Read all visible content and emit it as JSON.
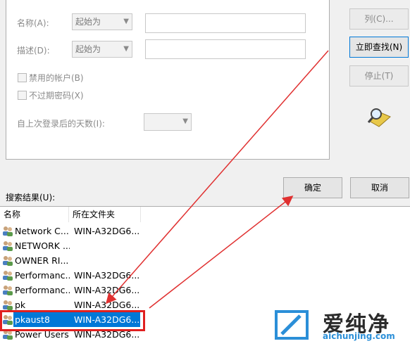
{
  "query": {
    "name_label": "名称(A):",
    "name_mode": "起始为",
    "desc_label": "描述(D):",
    "desc_mode": "起始为",
    "disabled_accounts": "禁用的帐户(B)",
    "no_expire_pwd": "不过期密码(X)",
    "days_since_logon": "自上次登录后的天数(I):"
  },
  "buttons": {
    "columns": "列(C)...",
    "find_now": "立即查找(N)",
    "stop": "停止(T)",
    "ok": "确定",
    "cancel": "取消"
  },
  "results": {
    "label": "搜索结果(U):",
    "columns": [
      "名称",
      "所在文件夹"
    ],
    "rows": [
      {
        "name": "Network C...",
        "folder": "WIN-A32DG6..."
      },
      {
        "name": "NETWORK ...",
        "folder": ""
      },
      {
        "name": "OWNER RI...",
        "folder": ""
      },
      {
        "name": "Performanc...",
        "folder": "WIN-A32DG6..."
      },
      {
        "name": "Performanc...",
        "folder": "WIN-A32DG6..."
      },
      {
        "name": "pk",
        "folder": "WIN-A32DG6..."
      },
      {
        "name": "pkaust8",
        "folder": "WIN-A32DG6..."
      },
      {
        "name": "Power Users",
        "folder": "WIN-A32DG6..."
      }
    ],
    "selected_index": 6
  },
  "watermark": {
    "brand": "爱纯净",
    "url": "aichunjing.com"
  },
  "colors": {
    "highlight_box": "#e02020",
    "arrow": "#e03030",
    "selection": "#0078d7"
  }
}
